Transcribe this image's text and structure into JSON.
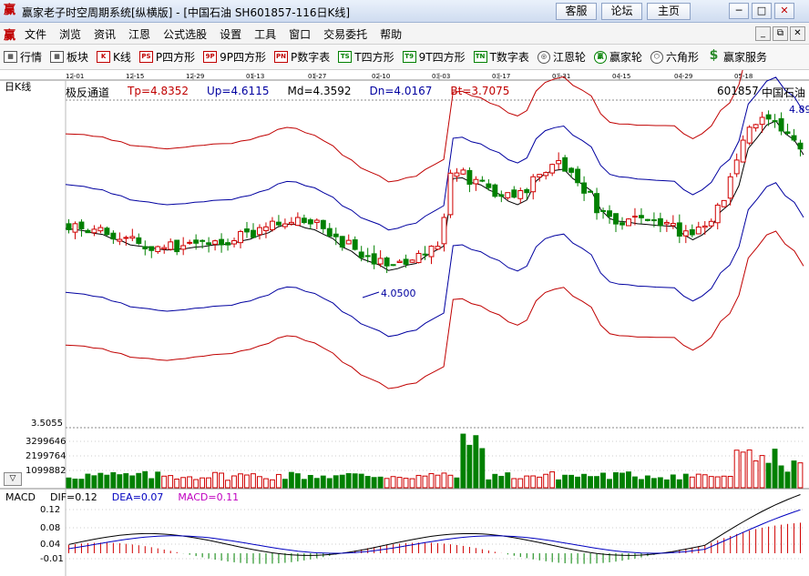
{
  "window": {
    "title": "赢家老子时空周期系统[纵横版] - [中国石油  SH601857-116日K线]",
    "buttons": [
      "客服",
      "论坛",
      "主页"
    ],
    "controls": [
      "minimize-icon",
      "maximize-icon",
      "close-icon"
    ]
  },
  "menu": {
    "logo": "赢",
    "items": [
      "文件",
      "浏览",
      "资讯",
      "江恩",
      "公式选股",
      "设置",
      "工具",
      "窗口",
      "交易委托",
      "帮助"
    ],
    "mdi_controls": [
      "_",
      "⧉",
      "✕"
    ]
  },
  "toolbar": {
    "items": [
      {
        "label": "行情",
        "icon": "grid-icon",
        "badge": "▦"
      },
      {
        "label": "板块",
        "icon": "blocks-icon",
        "badge": "▦"
      },
      {
        "label": "K线",
        "icon": "candlestick-icon",
        "badge": "K"
      },
      {
        "label": "P四方形",
        "icon": "p-square-icon",
        "badge": "PS"
      },
      {
        "label": "9P四方形",
        "icon": "9p-square-icon",
        "badge": "9P"
      },
      {
        "label": "P数字表",
        "icon": "p-number-table-icon",
        "badge": "PN"
      },
      {
        "label": "T四方形",
        "icon": "t-square-icon",
        "badge": "TS"
      },
      {
        "label": "9T四方形",
        "icon": "9t-square-icon",
        "badge": "T9"
      },
      {
        "label": "T数字表",
        "icon": "t-number-table-icon",
        "badge": "TN"
      },
      {
        "label": "江恩轮",
        "icon": "gann-wheel-icon",
        "badge": "◎"
      },
      {
        "label": "赢家轮",
        "icon": "winner-wheel-icon",
        "badge": "赢"
      },
      {
        "label": "六角形",
        "icon": "hexagon-icon",
        "badge": "⬡"
      },
      {
        "label": "赢家服务",
        "icon": "dollar-icon",
        "badge": "$"
      }
    ]
  },
  "chart": {
    "period_label": "日K线",
    "indicator": {
      "name": "极反通道",
      "Tp": "Tp=4.8352",
      "Up": "Up=4.6115",
      "Md": "Md=4.3592",
      "Dn": "Dn=4.0167",
      "Bt": "Bt=3.7075"
    },
    "stock_code": "601857",
    "stock_name": "中国石油",
    "date_ticks": [
      "12-01",
      "12-15",
      "12-29",
      "01-13",
      "01-27",
      "02-10",
      "03-03",
      "03-17",
      "03-31",
      "04-15",
      "04-29",
      "05-18"
    ],
    "low_annotation": "4.0500",
    "high_annotation": "4.89",
    "price_axis_label": "3.5055",
    "volume_ticks": [
      "3299646",
      "2199764",
      "1099882"
    ],
    "macd": {
      "name": "MACD",
      "DIF": "DIF=0.12",
      "DEA": "DEA=0.07",
      "MACD": "MACD=0.11",
      "ticks": [
        "0.12",
        "0.08",
        "0.04",
        "-0.01"
      ]
    },
    "colors": {
      "up": "#d00000",
      "down": "#008000",
      "outer_band": "#c00000",
      "inner_band": "#0000a0",
      "middle": "#000000",
      "dea": "#0000c0"
    }
  }
}
